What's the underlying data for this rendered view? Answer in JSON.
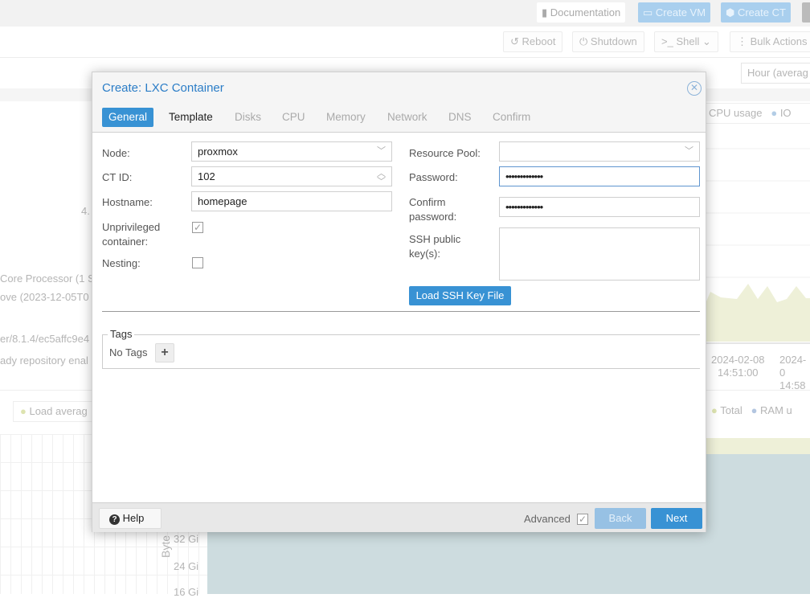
{
  "topbar": {
    "documentation": "Documentation",
    "create_vm": "Create VM",
    "create_ct": "Create CT"
  },
  "toolbar": {
    "reboot": "Reboot",
    "shutdown": "Shutdown",
    "shell": "Shell",
    "bulk_actions": "Bulk Actions",
    "timeframe": "Hour (averag"
  },
  "background": {
    "summary_lines": [
      "4.",
      "Core Processor (1 S",
      "ove (2023-12-05T0",
      "er/8.1.4/ec5affc9e4",
      "ady repository enal"
    ],
    "cpu_legend": [
      "CPU usage",
      "IO"
    ],
    "x_ticks": [
      {
        "date": "2024-02-08",
        "time": "14:51:00"
      },
      {
        "date": "2024-0",
        "time": "14:58"
      }
    ],
    "load_legend": "Load averag",
    "mem_legend": [
      "Total",
      "RAM u"
    ],
    "mem_ylabel": "Byte",
    "mem_yticks": [
      "32 Gi",
      "24 Gi",
      "16 Gi"
    ]
  },
  "dialog": {
    "title": "Create: LXC Container",
    "tabs": [
      "General",
      "Template",
      "Disks",
      "CPU",
      "Memory",
      "Network",
      "DNS",
      "Confirm"
    ],
    "active_tab": "General",
    "left": {
      "node_label": "Node:",
      "node_value": "proxmox",
      "ctid_label": "CT ID:",
      "ctid_value": "102",
      "hostname_label": "Hostname:",
      "hostname_value": "homepage",
      "unpriv_label": "Unprivileged container:",
      "unpriv_checked": true,
      "nesting_label": "Nesting:",
      "nesting_checked": false
    },
    "right": {
      "pool_label": "Resource Pool:",
      "pool_value": "",
      "password_label": "Password:",
      "password_value": "•••••••••••••",
      "confirm_label": "Confirm password:",
      "confirm_value": "•••••••••••••",
      "ssh_label": "SSH public key(s):",
      "ssh_value": "",
      "load_ssh": "Load SSH Key File"
    },
    "tags": {
      "legend": "Tags",
      "value": "No Tags",
      "add": "+"
    },
    "footer": {
      "help": "Help",
      "advanced": "Advanced",
      "advanced_checked": true,
      "back": "Back",
      "next": "Next"
    }
  },
  "colors": {
    "accent": "#3892d4",
    "title": "#2b7dc7"
  }
}
